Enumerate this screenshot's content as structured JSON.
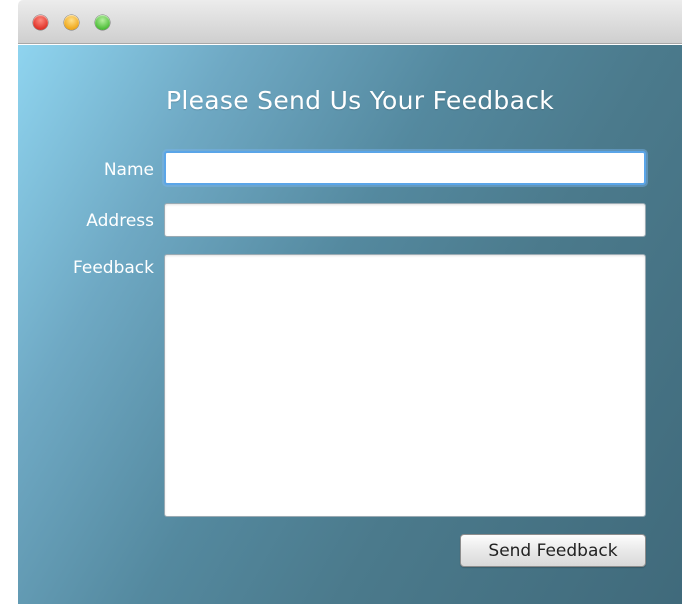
{
  "form": {
    "title": "Please Send Us Your Feedback",
    "name_label": "Name",
    "name_value": "",
    "address_label": "Address",
    "address_value": "",
    "feedback_label": "Feedback",
    "feedback_value": "",
    "send_button": "Send Feedback"
  },
  "window": {
    "buttons": [
      "close",
      "minimize",
      "zoom"
    ]
  },
  "colors": {
    "close": "#e0342a",
    "minimize": "#f0a91d",
    "zoom": "#4fbf3a",
    "focus_ring": "#5aa5e8",
    "background_light": "#8fd4ef",
    "background_dark": "#406a7b"
  }
}
